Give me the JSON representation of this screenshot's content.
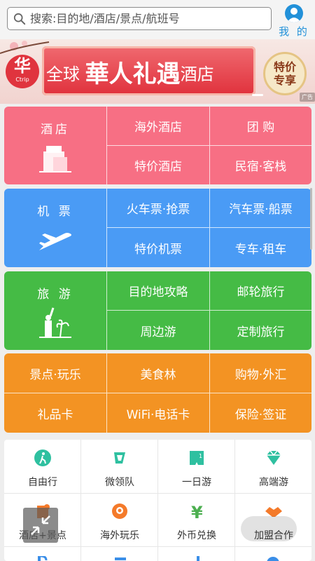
{
  "search": {
    "placeholder": "搜索:目的地/酒店/景点/航班号"
  },
  "profile": {
    "label": "我 的"
  },
  "banner": {
    "logo_main": "华",
    "logo_sub": "Ctrip",
    "title_prefix": "全球",
    "title_big": "華人礼遇",
    "title_suffix": "酒店",
    "badge_line1": "特价",
    "badge_line2": "专享",
    "ad_tag": "广告"
  },
  "hotel": {
    "main": "酒店",
    "cells": [
      "海外酒店",
      "团 购",
      "特价酒店",
      "民宿·客栈"
    ]
  },
  "flight": {
    "main": "机 票",
    "cells": [
      "火车票·抢票",
      "汽车票·船票",
      "特价机票",
      "专车·租车"
    ]
  },
  "travel": {
    "main": "旅 游",
    "cells": [
      "目的地攻略",
      "邮轮旅行",
      "周边游",
      "定制旅行"
    ]
  },
  "fun": {
    "cells": [
      "景点·玩乐",
      "美食林",
      "购物·外汇",
      "礼品卡",
      "WiFi·电话卡",
      "保险·签证"
    ]
  },
  "quick": {
    "items": [
      "自由行",
      "微领队",
      "一日游",
      "高端游",
      "酒店+景点",
      "海外玩乐",
      "外币兑换",
      "加盟合作"
    ]
  },
  "colors": {
    "hotel": "#f76f84",
    "flight": "#4a9bf5",
    "travel": "#45bb45",
    "fun": "#f39323",
    "accent": "#2291d9"
  }
}
